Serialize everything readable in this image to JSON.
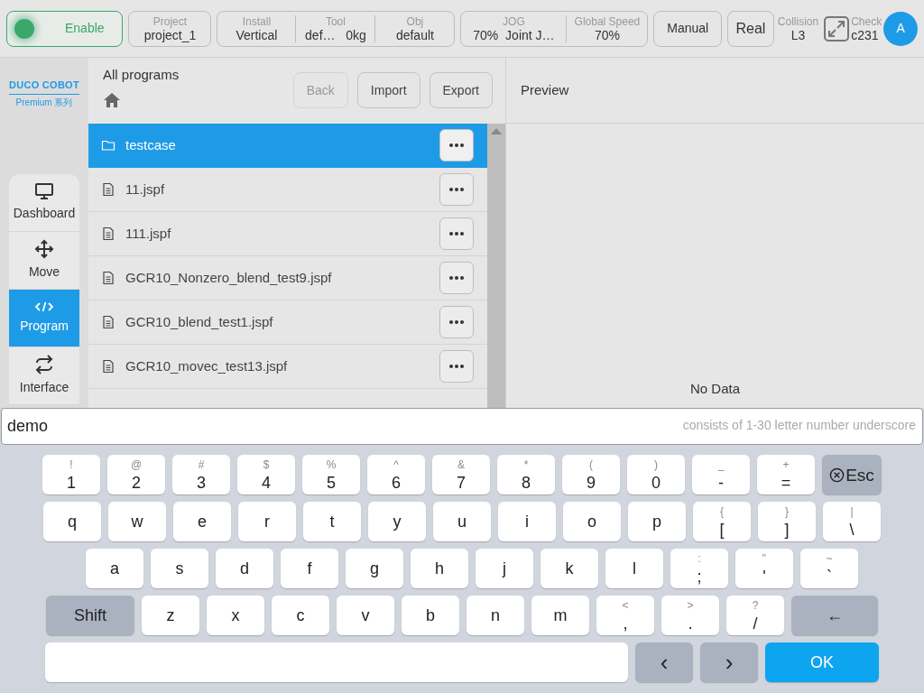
{
  "top_bar": {
    "enable": {
      "label": "Enable",
      "on": true
    },
    "groups": [
      {
        "fields": [
          {
            "label": "Project",
            "value": "project_1"
          }
        ]
      },
      {
        "fields": [
          {
            "label": "Install",
            "value": "Vertical"
          },
          {
            "label": "Tool",
            "value": "def…   0kg"
          },
          {
            "label": "Obj",
            "value": "default"
          }
        ]
      },
      {
        "fields": [
          {
            "label": "JOG",
            "value": "70%  Joint J…"
          },
          {
            "label": "Global Speed",
            "value": "70%"
          }
        ]
      }
    ],
    "mode_button": "Manual",
    "real_button": "Real",
    "collision": {
      "label": "Collision",
      "value": "L3"
    },
    "check": {
      "label": "Check",
      "value": "c231"
    },
    "avatar": "A"
  },
  "logo": {
    "brand": "DUCO COBOT",
    "series": "Premium 系列"
  },
  "nav": [
    {
      "kind": "monitor",
      "label": "Dashboard",
      "selected": false
    },
    {
      "kind": "move",
      "label": "Move",
      "selected": false
    },
    {
      "kind": "code",
      "label": "Program",
      "selected": true
    },
    {
      "kind": "swap",
      "label": "Interface",
      "selected": false
    }
  ],
  "browser": {
    "title": "All programs",
    "buttons": [
      {
        "label": "Back",
        "disabled": true
      },
      {
        "label": "Import",
        "disabled": false
      },
      {
        "label": "Export",
        "disabled": false
      }
    ],
    "files": [
      {
        "kind": "folder",
        "name": "testcase",
        "selected": true
      },
      {
        "kind": "file",
        "name": "11.jspf",
        "selected": false
      },
      {
        "kind": "file",
        "name": "111.jspf",
        "selected": false
      },
      {
        "kind": "file",
        "name": "GCR10_Nonzero_blend_test9.jspf",
        "selected": false
      },
      {
        "kind": "file",
        "name": "GCR10_blend_test1.jspf",
        "selected": false
      },
      {
        "kind": "file",
        "name": "GCR10_movec_test13.jspf",
        "selected": false
      }
    ]
  },
  "preview": {
    "title": "Preview",
    "empty": "No Data"
  },
  "input": {
    "value": "demo",
    "placeholder": "consists of 1-30 letter number underscore"
  },
  "keyboard": [
    [
      {
        "k": "1",
        "s": "!"
      },
      {
        "k": "2",
        "s": "@"
      },
      {
        "k": "3",
        "s": "#"
      },
      {
        "k": "4",
        "s": "$"
      },
      {
        "k": "5",
        "s": "%"
      },
      {
        "k": "6",
        "s": "^"
      },
      {
        "k": "7",
        "s": "&"
      },
      {
        "k": "8",
        "s": "*"
      },
      {
        "k": "9",
        "s": "("
      },
      {
        "k": "0",
        "s": ")"
      },
      {
        "k": "-",
        "s": "_"
      },
      {
        "k": "=",
        "s": "+"
      },
      {
        "k": "Esc",
        "kind": "esc"
      }
    ],
    [
      {
        "k": "q"
      },
      {
        "k": "w"
      },
      {
        "k": "e"
      },
      {
        "k": "r"
      },
      {
        "k": "t"
      },
      {
        "k": "y"
      },
      {
        "k": "u"
      },
      {
        "k": "i"
      },
      {
        "k": "o"
      },
      {
        "k": "p"
      },
      {
        "k": "[",
        "s": "{"
      },
      {
        "k": "]",
        "s": "}"
      },
      {
        "k": "\\",
        "s": "|"
      }
    ],
    [
      {
        "k": "a"
      },
      {
        "k": "s"
      },
      {
        "k": "d"
      },
      {
        "k": "f"
      },
      {
        "k": "g"
      },
      {
        "k": "h"
      },
      {
        "k": "j"
      },
      {
        "k": "k"
      },
      {
        "k": "l"
      },
      {
        "k": ";",
        "s": ":"
      },
      {
        "k": "'",
        "s": "\""
      },
      {
        "k": "`",
        "s": "~"
      }
    ],
    [
      {
        "k": "Shift",
        "kind": "shift"
      },
      {
        "k": "z"
      },
      {
        "k": "x"
      },
      {
        "k": "c"
      },
      {
        "k": "v"
      },
      {
        "k": "b"
      },
      {
        "k": "n"
      },
      {
        "k": "m"
      },
      {
        "k": ",",
        "s": "<"
      },
      {
        "k": ".",
        "s": ">"
      },
      {
        "k": "/",
        "s": "?"
      },
      {
        "k": "←",
        "kind": "back"
      }
    ],
    [
      {
        "kind": "space"
      },
      {
        "k": "‹",
        "kind": "arrow"
      },
      {
        "k": "›",
        "kind": "arrow"
      },
      {
        "k": "OK",
        "kind": "ok"
      }
    ]
  ]
}
